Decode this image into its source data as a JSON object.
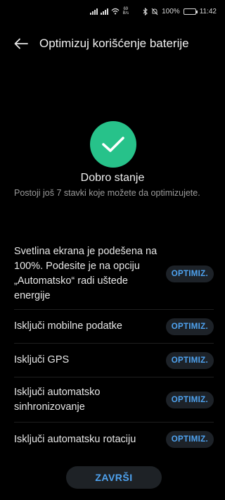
{
  "status_bar": {
    "net_speed_value": "69",
    "net_speed_unit": "B/s",
    "battery_percent": "100%",
    "time": "11:42"
  },
  "header": {
    "title": "Optimizuj korišćenje baterije"
  },
  "status": {
    "title": "Dobro stanje",
    "subtitle": "Postoji još 7 stavki koje možete da optimizujete."
  },
  "items": [
    {
      "label": "Svetlina ekrana je podešena na 100%. Podesite je na opciju „Automatsko“ radi uštede energije",
      "button": "OPTIMIZ."
    },
    {
      "label": "Isključi mobilne podatke",
      "button": "OPTIMIZ."
    },
    {
      "label": "Isključi GPS",
      "button": "OPTIMIZ."
    },
    {
      "label": "Isključi automatsko sinhronizovanje",
      "button": "OPTIMIZ."
    },
    {
      "label": "Isključi automatsku rotaciju",
      "button": "OPTIMIZ."
    }
  ],
  "footer": {
    "done_label": "ZAVRŠI"
  },
  "colors": {
    "accent": "#4fa3f0",
    "success": "#27c28a",
    "background": "#000000"
  }
}
